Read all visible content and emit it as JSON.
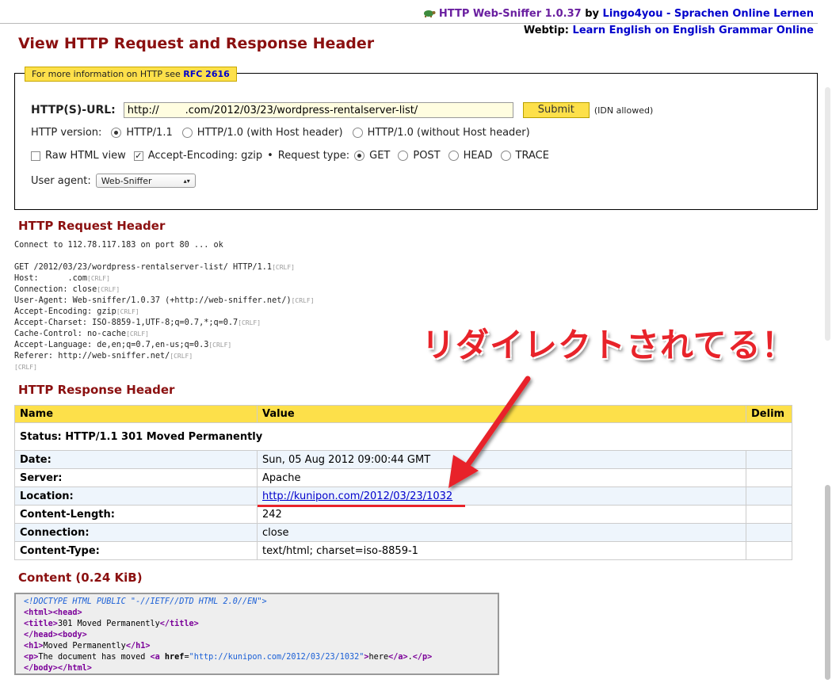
{
  "top": {
    "brand": "HTTP Web-Sniffer 1.0.37",
    "by": "by",
    "author_link": "Lingo4you - Sprachen Online Lernen",
    "webtip_label": "Webtip:",
    "webtip_link": "Learn English on English Grammar Online"
  },
  "page_title": "View HTTP Request and Response Header",
  "form": {
    "legend_text": "For more information on HTTP see",
    "legend_link": "RFC 2616",
    "url_label": "HTTP(S)-URL:",
    "url_value": "http://        .com/2012/03/23/wordpress-rentalserver-list/",
    "submit_label": "Submit",
    "idn_note": "(IDN allowed)",
    "version_label": "HTTP version:",
    "versions": [
      "HTTP/1.1",
      "HTTP/1.0 (with Host header)",
      "HTTP/1.0 (without Host header)"
    ],
    "selected_version": "HTTP/1.1",
    "raw_html_label": "Raw HTML view",
    "accept_encoding_label": "Accept-Encoding: gzip",
    "bullet": "•",
    "request_type_label": "Request type:",
    "request_types": [
      "GET",
      "POST",
      "HEAD",
      "TRACE"
    ],
    "selected_request_type": "GET",
    "user_agent_label": "User agent:",
    "user_agent_value": "Web-Sniffer"
  },
  "request": {
    "heading": "HTTP Request Header",
    "connect_line": "Connect to 112.78.117.183 on port 80 ... ok",
    "lines": [
      "GET /2012/03/23/wordpress-rentalserver-list/ HTTP/1.1",
      "Host:      .com",
      "Connection: close",
      "User-Agent: Web-sniffer/1.0.37 (+http://web-sniffer.net/)",
      "Accept-Encoding: gzip",
      "Accept-Charset: ISO-8859-1,UTF-8;q=0.7,*;q=0.7",
      "Cache-Control: no-cache",
      "Accept-Language: de,en;q=0.7,en-us;q=0.3",
      "Referer: http://web-sniffer.net/"
    ],
    "crlf": "[CRLF]"
  },
  "response": {
    "heading": "HTTP Response Header",
    "columns": [
      "Name",
      "Value",
      "Delim"
    ],
    "status": "Status: HTTP/1.1 301 Moved Permanently",
    "rows": [
      {
        "name": "Date:",
        "value": "Sun, 05 Aug 2012 09:00:44 GMT"
      },
      {
        "name": "Server:",
        "value": "Apache"
      },
      {
        "name": "Location:",
        "value": "http://kunipon.com/2012/03/23/1032"
      },
      {
        "name": "Content-Length:",
        "value": "242"
      },
      {
        "name": "Connection:",
        "value": "close"
      },
      {
        "name": "Content-Type:",
        "value": "text/html; charset=iso-8859-1"
      }
    ]
  },
  "content": {
    "heading": "Content (0.24 KiB)",
    "doctype": "<!DOCTYPE HTML PUBLIC \"-//IETF//DTD HTML 2.0//EN\">",
    "title_text": "301 Moved Permanently",
    "h1_text": "Moved Permanently",
    "p_text": "The document has moved",
    "href": "\"http://kunipon.com/2012/03/23/1032\"",
    "link_text": "here",
    "p_end": "."
  },
  "annotation": {
    "text": "リダイレクトされてる！",
    "color": "#e8232a"
  },
  "colors": {
    "heading": "#8b1010",
    "accent_yellow": "#fde04a",
    "link": "#0000cc"
  }
}
